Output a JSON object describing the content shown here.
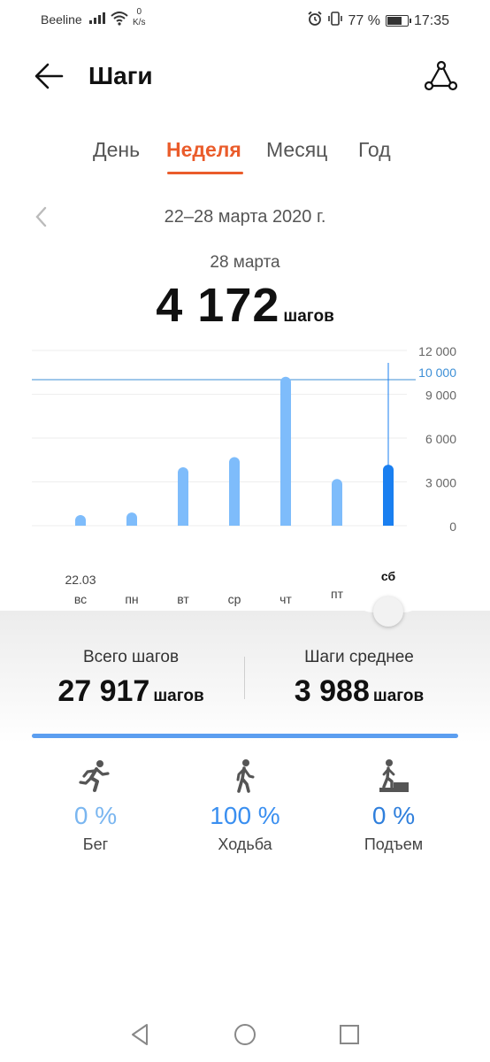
{
  "status_bar": {
    "carrier": "Beeline",
    "speed_value": "0",
    "speed_unit": "K/s",
    "battery_percent": "77 %",
    "battery_level": 0.77,
    "time": "17:35"
  },
  "header": {
    "title": "Шаги"
  },
  "tabs": [
    {
      "label": "День",
      "active": false
    },
    {
      "label": "Неделя",
      "active": true
    },
    {
      "label": "Месяц",
      "active": false
    },
    {
      "label": "Год",
      "active": false
    }
  ],
  "range": {
    "text": "22–28 марта 2020 г."
  },
  "selection": {
    "date": "28 марта",
    "steps": "4 172",
    "unit": "шагов"
  },
  "chart_data": {
    "type": "bar",
    "categories": [
      "вс",
      "пн",
      "вт",
      "ср",
      "чт",
      "пт",
      "сб"
    ],
    "first_date_label": "22.03",
    "values": [
      500,
      900,
      4000,
      4700,
      10200,
      3200,
      4172
    ],
    "selected_index": 6,
    "ylim": [
      0,
      12000
    ],
    "y_ticks": [
      0,
      3000,
      6000,
      9000,
      12000
    ],
    "y_tick_labels": [
      "0",
      "3 000",
      "6 000",
      "9 000",
      "12 000"
    ],
    "goal": 10000,
    "goal_label": "10 000",
    "colors": {
      "bar": "#7ebcfb",
      "selected": "#1a7ff0",
      "goal": "#3d8fd6"
    }
  },
  "summary": {
    "total_label": "Всего шагов",
    "total_value": "27 917",
    "total_unit": "шагов",
    "avg_label": "Шаги среднее",
    "avg_value": "3 988",
    "avg_unit": "шагов",
    "progress": 1.0
  },
  "activities": [
    {
      "name": "Бег",
      "percent": "0 %",
      "icon": "running-icon"
    },
    {
      "name": "Ходьба",
      "percent": "100 %",
      "icon": "walking-icon"
    },
    {
      "name": "Подъем",
      "percent": "0 %",
      "icon": "climbing-icon"
    }
  ],
  "colors": {
    "accent": "#ea5c2b",
    "blue": "#1a7ff0"
  }
}
